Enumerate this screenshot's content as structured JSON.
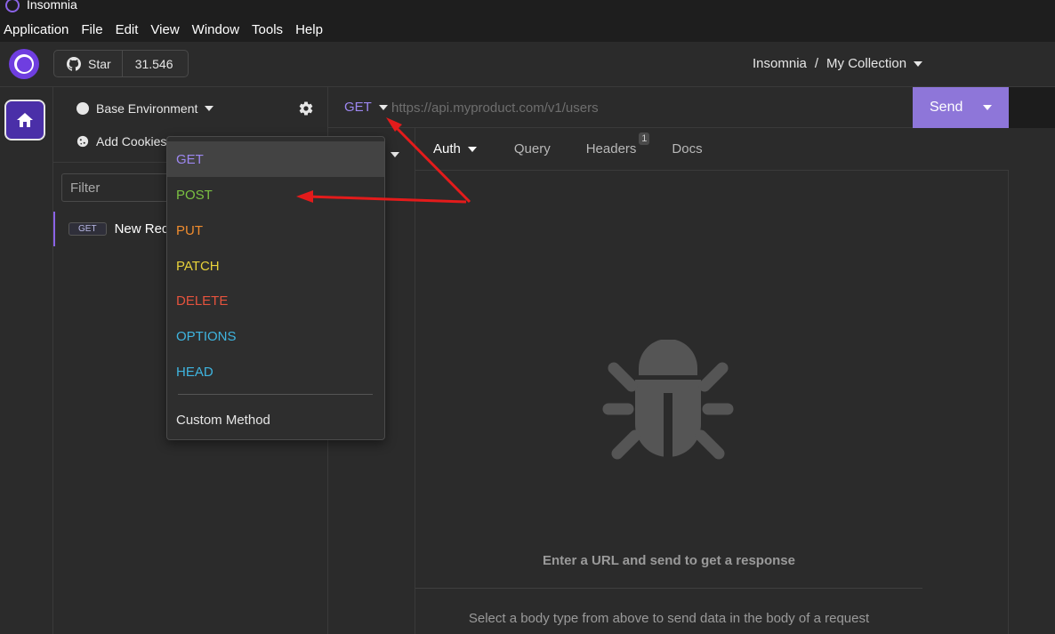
{
  "window": {
    "title": "Insomnia"
  },
  "menubar": {
    "items": [
      "Application",
      "File",
      "Edit",
      "View",
      "Window",
      "Tools",
      "Help"
    ]
  },
  "header": {
    "logo_icon": "insomnia-logo-icon",
    "star_label": "Star",
    "star_count": "31.546",
    "breadcrumb": {
      "project": "Insomnia",
      "separator": "/",
      "collection": "My Collection"
    }
  },
  "rail": {
    "home_icon": "home-icon"
  },
  "sidebar": {
    "environment": "Base Environment",
    "add_cookies": "Add Cookies",
    "filter_placeholder": "Filter",
    "requests": [
      {
        "method": "GET",
        "name": "New Req"
      }
    ]
  },
  "request": {
    "method": "GET",
    "url_placeholder": "https://api.myproduct.com/v1/users",
    "send_label": "Send"
  },
  "tabs": {
    "auth": "Auth",
    "query": "Query",
    "headers": "Headers",
    "headers_count": "1",
    "docs": "Docs"
  },
  "response": {
    "empty_icon": "bug-icon",
    "empty_title": "Enter a URL and send to get a response",
    "empty_hint": "Select a body type from above to send data in the body of a request"
  },
  "method_menu": {
    "items": [
      {
        "label": "GET",
        "color": "#9d87f0"
      },
      {
        "label": "POST",
        "color": "#7bc142"
      },
      {
        "label": "PUT",
        "color": "#f08c2e"
      },
      {
        "label": "PATCH",
        "color": "#e8d23a"
      },
      {
        "label": "DELETE",
        "color": "#e5533d"
      },
      {
        "label": "OPTIONS",
        "color": "#3fb5e0"
      },
      {
        "label": "HEAD",
        "color": "#3fb5e0"
      }
    ],
    "custom": "Custom Method"
  },
  "colors": {
    "accent": "#8e76d9",
    "annotation_arrow": "#e31b1b"
  }
}
